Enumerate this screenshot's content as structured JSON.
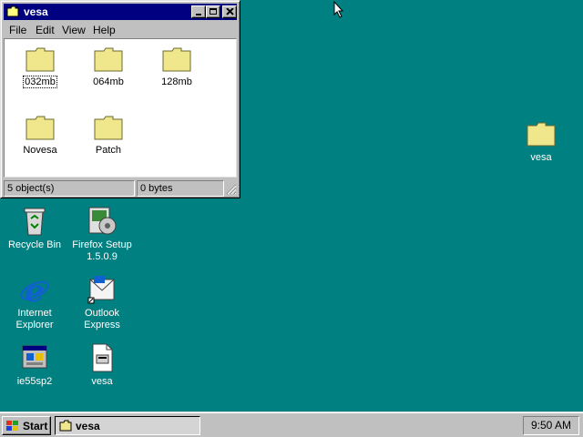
{
  "window": {
    "title": "vesa",
    "menu": [
      "File",
      "Edit",
      "View",
      "Help"
    ],
    "folders": [
      "032mb",
      "064mb",
      "128mb",
      "Novesa",
      "Patch"
    ],
    "status_objects": "5 object(s)",
    "status_bytes": "0 bytes"
  },
  "desktop": {
    "vesa_folder": "vesa",
    "recycle_bin": "Recycle Bin",
    "firefox_setup_line1": "Firefox Setup",
    "firefox_setup_line2": "1.5.0.9",
    "ie_line1": "Internet",
    "ie_line2": "Explorer",
    "outlook_line1": "Outlook",
    "outlook_line2": "Express",
    "ie55sp2": "ie55sp2",
    "vesa_file": "vesa"
  },
  "taskbar": {
    "start_label": "Start",
    "task_label": "vesa",
    "clock": "9:50 AM"
  },
  "colors": {
    "desktop": "#008080",
    "titlebar": "#000080",
    "folder": "#f0e68c"
  }
}
